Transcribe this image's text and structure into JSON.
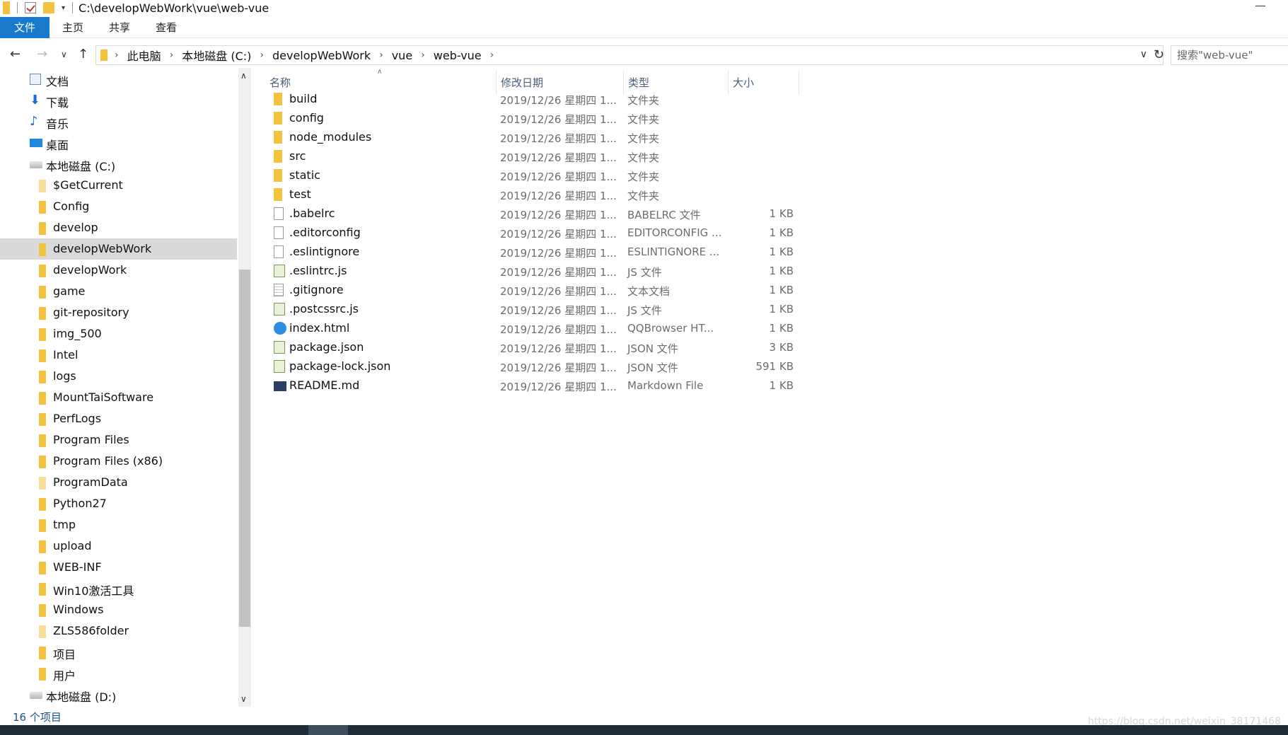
{
  "window": {
    "title": "C:\\developWebWork\\vue\\web-vue"
  },
  "ribbon": {
    "tabs": [
      "文件",
      "主页",
      "共享",
      "查看"
    ]
  },
  "address": {
    "crumbs": [
      "此电脑",
      "本地磁盘 (C:)",
      "developWebWork",
      "vue",
      "web-vue"
    ],
    "search_placeholder": "搜索\"web-vue\""
  },
  "navpane": {
    "items": [
      {
        "label": "文档",
        "icon": "documents-icon"
      },
      {
        "label": "下载",
        "icon": "download-icon"
      },
      {
        "label": "音乐",
        "icon": "music-icon"
      },
      {
        "label": "桌面",
        "icon": "desktop-icon"
      },
      {
        "label": "本地磁盘 (C:)",
        "icon": "drive-icon"
      },
      {
        "label": "$GetCurrent",
        "icon": "folder-icon"
      },
      {
        "label": "Config",
        "icon": "folder-icon"
      },
      {
        "label": "develop",
        "icon": "folder-icon"
      },
      {
        "label": "developWebWork",
        "icon": "folder-icon",
        "selected": true
      },
      {
        "label": "developWork",
        "icon": "folder-icon"
      },
      {
        "label": "game",
        "icon": "folder-icon"
      },
      {
        "label": "git-repository",
        "icon": "folder-icon"
      },
      {
        "label": "img_500",
        "icon": "folder-icon"
      },
      {
        "label": "Intel",
        "icon": "folder-icon"
      },
      {
        "label": "logs",
        "icon": "folder-icon"
      },
      {
        "label": "MountTaiSoftware",
        "icon": "folder-icon"
      },
      {
        "label": "PerfLogs",
        "icon": "folder-icon"
      },
      {
        "label": "Program Files",
        "icon": "folder-icon"
      },
      {
        "label": "Program Files (x86)",
        "icon": "folder-icon"
      },
      {
        "label": "ProgramData",
        "icon": "folder-icon"
      },
      {
        "label": "Python27",
        "icon": "folder-icon"
      },
      {
        "label": "tmp",
        "icon": "folder-icon"
      },
      {
        "label": "upload",
        "icon": "folder-icon"
      },
      {
        "label": "WEB-INF",
        "icon": "folder-icon"
      },
      {
        "label": "Win10激活工具",
        "icon": "folder-icon"
      },
      {
        "label": "Windows",
        "icon": "folder-icon"
      },
      {
        "label": "ZLS586folder",
        "icon": "folder-icon"
      },
      {
        "label": "项目",
        "icon": "folder-icon"
      },
      {
        "label": "用户",
        "icon": "folder-icon"
      },
      {
        "label": "本地磁盘 (D:)",
        "icon": "drive-icon"
      }
    ]
  },
  "columns": {
    "name": "名称",
    "date": "修改日期",
    "type": "类型",
    "size": "大小"
  },
  "files": [
    {
      "name": "build",
      "date": "2019/12/26 星期四 1...",
      "type": "文件夹",
      "size": "",
      "icon": "folder-icon"
    },
    {
      "name": "config",
      "date": "2019/12/26 星期四 1...",
      "type": "文件夹",
      "size": "",
      "icon": "folder-icon"
    },
    {
      "name": "node_modules",
      "date": "2019/12/26 星期四 1...",
      "type": "文件夹",
      "size": "",
      "icon": "folder-icon"
    },
    {
      "name": "src",
      "date": "2019/12/26 星期四 1...",
      "type": "文件夹",
      "size": "",
      "icon": "folder-icon"
    },
    {
      "name": "static",
      "date": "2019/12/26 星期四 1...",
      "type": "文件夹",
      "size": "",
      "icon": "folder-icon"
    },
    {
      "name": "test",
      "date": "2019/12/26 星期四 1...",
      "type": "文件夹",
      "size": "",
      "icon": "folder-icon"
    },
    {
      "name": ".babelrc",
      "date": "2019/12/26 星期四 1...",
      "type": "BABELRC 文件",
      "size": "1 KB",
      "icon": "file-icon"
    },
    {
      "name": ".editorconfig",
      "date": "2019/12/26 星期四 1...",
      "type": "EDITORCONFIG ...",
      "size": "1 KB",
      "icon": "file-icon"
    },
    {
      "name": ".eslintignore",
      "date": "2019/12/26 星期四 1...",
      "type": "ESLINTIGNORE ...",
      "size": "1 KB",
      "icon": "file-icon"
    },
    {
      "name": ".eslintrc.js",
      "date": "2019/12/26 星期四 1...",
      "type": "JS 文件",
      "size": "1 KB",
      "icon": "js-file-icon"
    },
    {
      "name": ".gitignore",
      "date": "2019/12/26 星期四 1...",
      "type": "文本文档",
      "size": "1 KB",
      "icon": "text-file-icon"
    },
    {
      "name": ".postcssrc.js",
      "date": "2019/12/26 星期四 1...",
      "type": "JS 文件",
      "size": "1 KB",
      "icon": "js-file-icon"
    },
    {
      "name": "index.html",
      "date": "2019/12/26 星期四 1...",
      "type": "QQBrowser HT...",
      "size": "1 KB",
      "icon": "browser-icon"
    },
    {
      "name": "package.json",
      "date": "2019/12/26 星期四 1...",
      "type": "JSON 文件",
      "size": "3 KB",
      "icon": "js-file-icon"
    },
    {
      "name": "package-lock.json",
      "date": "2019/12/26 星期四 1...",
      "type": "JSON 文件",
      "size": "591 KB",
      "icon": "js-file-icon"
    },
    {
      "name": "README.md",
      "date": "2019/12/26 星期四 1...",
      "type": "Markdown File",
      "size": "1 KB",
      "icon": "markdown-icon"
    }
  ],
  "status": {
    "count": "16 个项目"
  },
  "watermark": "https://blog.csdn.net/weixin_38171468"
}
